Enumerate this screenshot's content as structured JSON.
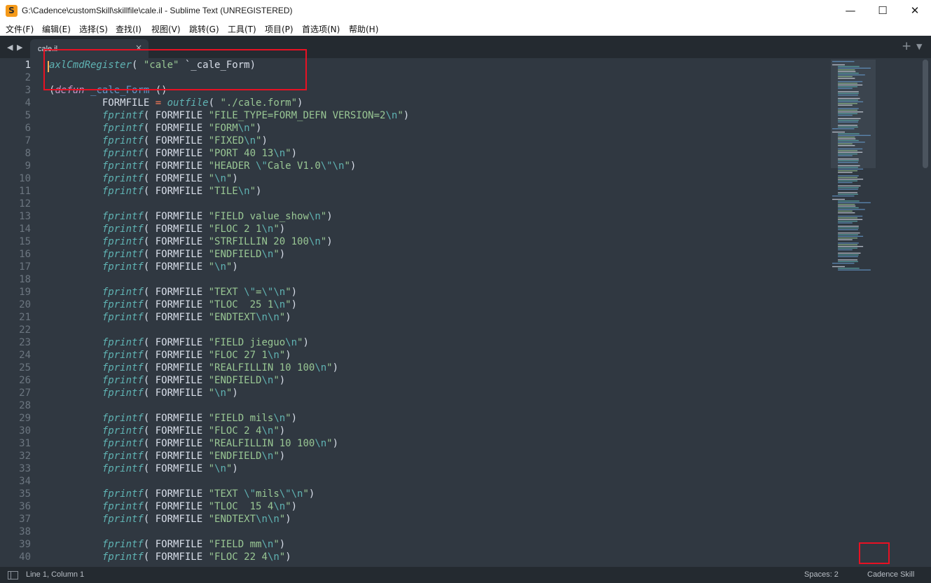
{
  "window": {
    "title": "G:\\Cadence\\customSkill\\skillfile\\cale.il - Sublime Text (UNREGISTERED)",
    "minimize": "—",
    "maximize": "☐",
    "close": "✕"
  },
  "menu": [
    "文件(F)",
    "编辑(E)",
    "选择(S)",
    "查找(I)",
    "视图(V)",
    "跳转(G)",
    "工具(T)",
    "项目(P)",
    "首选项(N)",
    "帮助(H)"
  ],
  "tab": {
    "label": "cale.il",
    "close": "×"
  },
  "tabbar": {
    "nav_left": "◀",
    "nav_right": "▶",
    "new_tab": "+",
    "tab_menu": "▼"
  },
  "statusbar": {
    "position": "Line 1, Column 1",
    "spaces": "Spaces: 2",
    "syntax": "Cadence Skill"
  },
  "editor": {
    "active_line": 1,
    "lines": [
      "axlCmdRegister( \"cale\" `_cale_Form)",
      "",
      "(defun _cale_Form ()",
      "         FORMFILE = outfile( \"./cale.form\")",
      "         fprintf( FORMFILE \"FILE_TYPE=FORM_DEFN VERSION=2\\n\")",
      "         fprintf( FORMFILE \"FORM\\n\")",
      "         fprintf( FORMFILE \"FIXED\\n\")",
      "         fprintf( FORMFILE \"PORT 40 13\\n\")",
      "         fprintf( FORMFILE \"HEADER \\\"Cale V1.0\\\"\\n\")",
      "         fprintf( FORMFILE \"\\n\")",
      "         fprintf( FORMFILE \"TILE\\n\")",
      "",
      "         fprintf( FORMFILE \"FIELD value_show\\n\")",
      "         fprintf( FORMFILE \"FLOC 2 1\\n\")",
      "         fprintf( FORMFILE \"STRFILLIN 20 100\\n\")",
      "         fprintf( FORMFILE \"ENDFIELD\\n\")",
      "         fprintf( FORMFILE \"\\n\")",
      "",
      "         fprintf( FORMFILE \"TEXT \\\"=\\\"\\n\")",
      "         fprintf( FORMFILE \"TLOC  25 1\\n\")",
      "         fprintf( FORMFILE \"ENDTEXT\\n\\n\")",
      "",
      "         fprintf( FORMFILE \"FIELD jieguo\\n\")",
      "         fprintf( FORMFILE \"FLOC 27 1\\n\")",
      "         fprintf( FORMFILE \"REALFILLIN 10 100\\n\")",
      "         fprintf( FORMFILE \"ENDFIELD\\n\")",
      "         fprintf( FORMFILE \"\\n\")",
      "",
      "         fprintf( FORMFILE \"FIELD mils\\n\")",
      "         fprintf( FORMFILE \"FLOC 2 4\\n\")",
      "         fprintf( FORMFILE \"REALFILLIN 10 100\\n\")",
      "         fprintf( FORMFILE \"ENDFIELD\\n\")",
      "         fprintf( FORMFILE \"\\n\")",
      "",
      "         fprintf( FORMFILE \"TEXT \\\"mils\\\"\\n\")",
      "         fprintf( FORMFILE \"TLOC  15 4\\n\")",
      "         fprintf( FORMFILE \"ENDTEXT\\n\\n\")",
      "",
      "         fprintf( FORMFILE \"FIELD mm\\n\")",
      "         fprintf( FORMFILE \"FLOC 22 4\\n\")"
    ]
  },
  "colors": {
    "accent": "#f9ae58",
    "annotation": "#e81123",
    "background": "#303841"
  }
}
